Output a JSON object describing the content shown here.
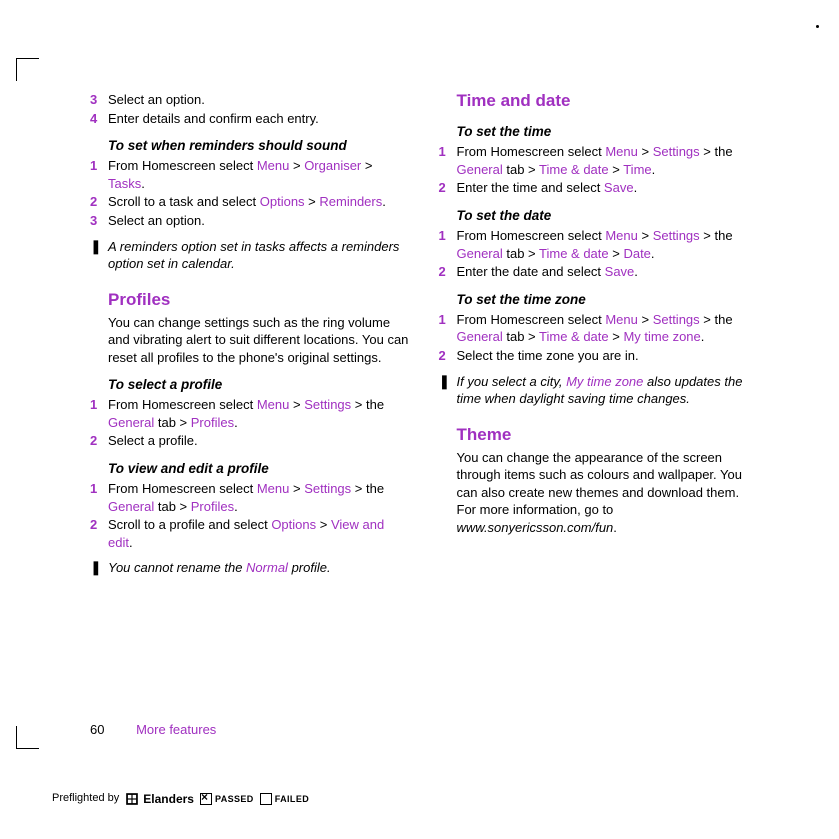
{
  "left": {
    "step3": "Select an option.",
    "step4": "Enter details and confirm each entry.",
    "sub_reminders": "To set when reminders should sound",
    "rem1_pre": "From Homescreen select ",
    "rem1_menu": "Menu",
    "rem1_gt1": " > ",
    "rem1_org": "Organiser",
    "rem1_gt2": " > ",
    "rem1_tasks": "Tasks",
    "rem1_dot": ".",
    "rem2_pre": "Scroll to a task and select ",
    "rem2_opt": "Options",
    "rem2_gt": " > ",
    "rem2_rem": "Reminders",
    "rem2_dot": ".",
    "rem3": "Select an option.",
    "note1": "A reminders option set in tasks affects a reminders option set in calendar.",
    "h2_profiles": "Profiles",
    "profiles_intro": "You can change settings such as the ring volume and vibrating alert to suit different locations. You can reset all profiles to the phone's original settings.",
    "sub_select_profile": "To select a profile",
    "sp1_pre": "From Homescreen select ",
    "sp1_menu": "Menu",
    "sp1_gt1": " > ",
    "sp1_set": "Settings",
    "sp1_mid": " > the ",
    "sp1_gen": "General",
    "sp1_post": " tab > ",
    "sp1_prof": "Profiles",
    "sp1_dot": ".",
    "sp2": "Select a profile.",
    "sub_view_edit": "To view and edit a profile",
    "ve1_pre": "From Homescreen select ",
    "ve1_menu": "Menu",
    "ve1_gt1": " > ",
    "ve1_set": "Settings",
    "ve1_mid": " > the ",
    "ve1_gen": "General",
    "ve1_post": " tab > ",
    "ve1_prof": "Profiles",
    "ve1_dot": ".",
    "ve2_pre": "Scroll to a profile and select ",
    "ve2_opt": "Options",
    "ve2_gt": " > ",
    "ve2_view": "View and edit",
    "ve2_dot": ".",
    "note2_pre": "You cannot rename the ",
    "note2_link": "Normal",
    "note2_post": " profile."
  },
  "right": {
    "h2_timedate": "Time and date",
    "sub_settime": "To set the time",
    "t1_pre": "From Homescreen select ",
    "t1_menu": "Menu",
    "t1_gt1": " > ",
    "t1_set": "Settings",
    "t1_mid": " > the ",
    "t1_gen": "General",
    "t1_post": " tab > ",
    "t1_td": "Time & date",
    "t1_gt2": " > ",
    "t1_time": "Time",
    "t1_dot": ".",
    "t2_pre": "Enter the time and select ",
    "t2_save": "Save",
    "t2_dot": ".",
    "sub_setdate": "To set the date",
    "d1_pre": "From Homescreen select ",
    "d1_menu": "Menu",
    "d1_gt1": " > ",
    "d1_set": "Settings",
    "d1_mid": " > the ",
    "d1_gen": "General",
    "d1_post": " tab > ",
    "d1_td": "Time & date",
    "d1_gt2": " > ",
    "d1_date": "Date",
    "d1_dot": ".",
    "d2_pre": "Enter the date and select ",
    "d2_save": "Save",
    "d2_dot": ".",
    "sub_settz": "To set the time zone",
    "z1_pre": "From Homescreen select ",
    "z1_menu": "Menu",
    "z1_gt1": " > ",
    "z1_set": "Settings",
    "z1_mid": " > the ",
    "z1_gen": "General",
    "z1_post": " tab > ",
    "z1_td": "Time & date",
    "z1_gt2": " > ",
    "z1_mtz": "My time zone",
    "z1_dot": ".",
    "z2": "Select the time zone you are in.",
    "note3_pre": "If you select a city, ",
    "note3_link": "My time zone",
    "note3_post": " also updates the time when daylight saving time changes.",
    "h2_theme": "Theme",
    "theme_text_pre": "You can change the appearance of the screen through items such as colours and wallpaper. You can also create new themes and download them. For more information, go to ",
    "theme_url": "www.sonyericsson.com/fun",
    "theme_dot": "."
  },
  "footer": {
    "page": "60",
    "section": "More features"
  },
  "preflight": {
    "label": "Preflighted by",
    "brand": "Elanders",
    "passed": "PASSED",
    "failed": "FAILED"
  },
  "nums": {
    "n1": "1",
    "n2": "2",
    "n3": "3",
    "n4": "4"
  },
  "icons": {
    "note": "❚"
  }
}
